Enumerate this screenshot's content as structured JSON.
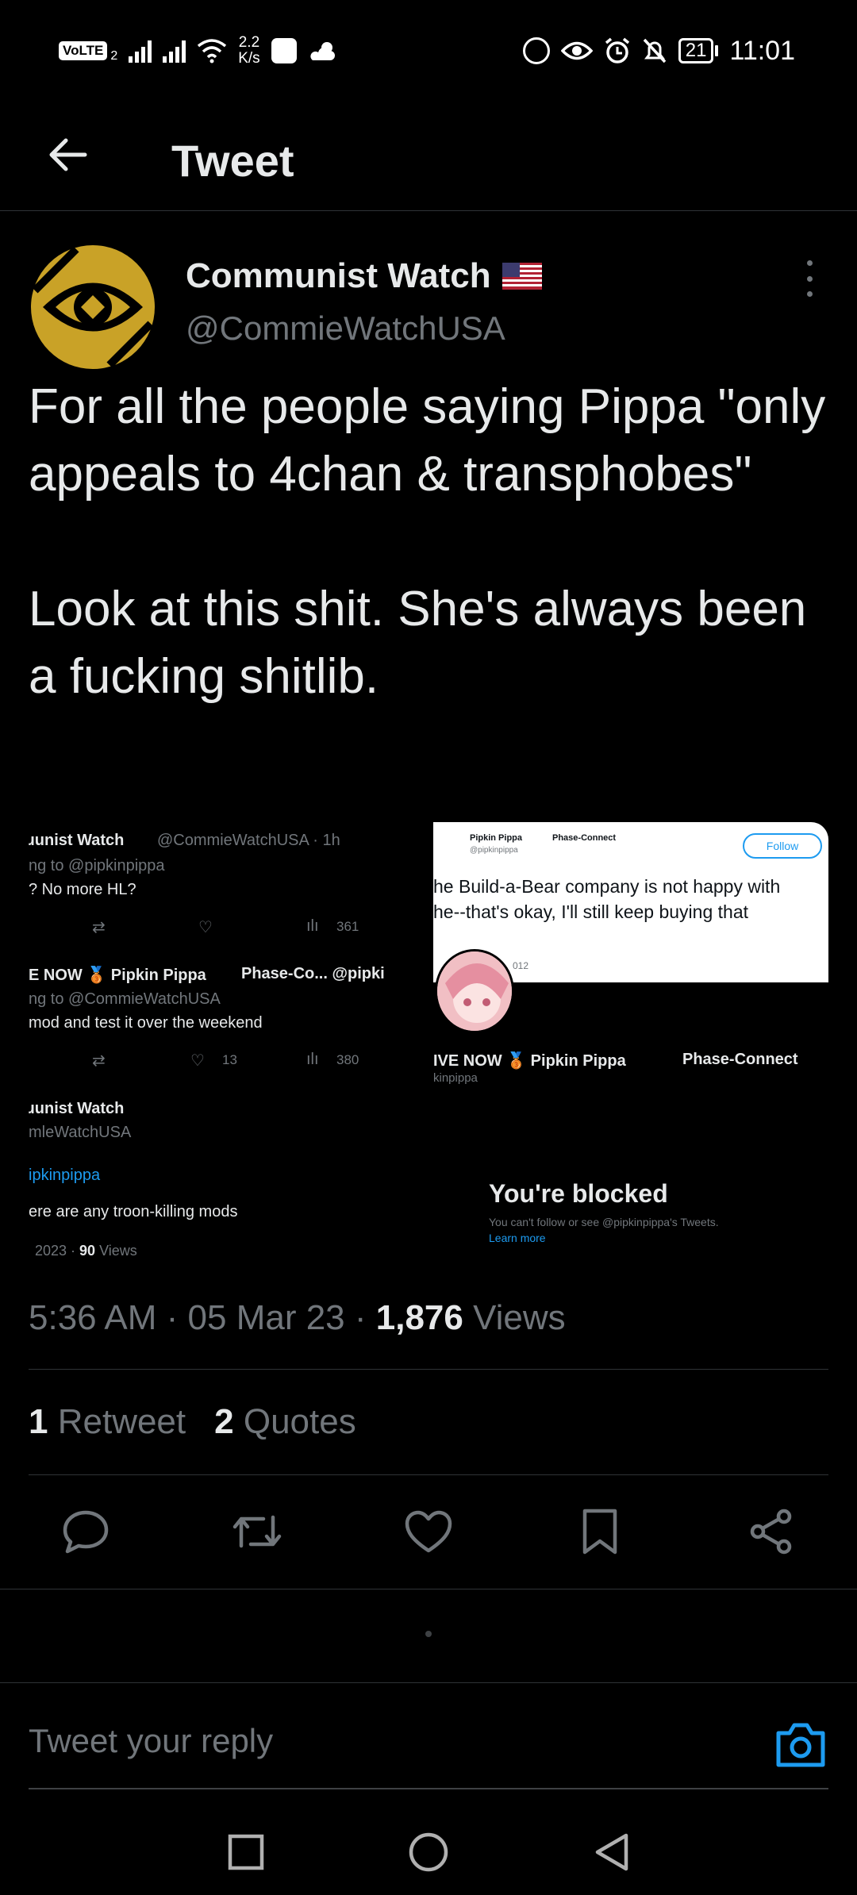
{
  "status_bar": {
    "volte": "VoLTE",
    "sim": "2",
    "net_speed_value": "2.2",
    "net_speed_unit": "K/s",
    "battery": "21",
    "time": "11:01"
  },
  "header": {
    "title": "Tweet"
  },
  "tweet": {
    "author_name": "Communist Watch",
    "author_handle": "@CommieWatchUSA",
    "text": "For all the people saying Pippa \"only appeals to 4chan & transphobes\"\n\nLook at this shit. She's always been a fucking shitlib.",
    "timestamp": "5:36 AM · 05 Mar 23 · ",
    "views_count": "1,876",
    "views_label": "Views"
  },
  "media": {
    "left": {
      "line1_name": "ɹunist Watch",
      "line1_handle": "@CommieWatchUSA · 1h",
      "line2": "ng to @pipkinpippa",
      "line3": "? No more HL?",
      "row1_views": "361",
      "line4_name": "E NOW 🥉 Pipkin Pippa",
      "line4_rest": "Phase-Co...  @pipki",
      "line5": "ng to @CommieWatchUSA",
      "line6": "mod and test it over the weekend",
      "row2_likes": "13",
      "row2_views": "380",
      "line7": "ɹunist Watch",
      "line8": "mleWatchUSA",
      "line9": "ipkinpippa",
      "line10": "ere are any troon-killing mods",
      "line11_date": "2023 · ",
      "line11_views": "90",
      "line11_label": "Views"
    },
    "right": {
      "card_name": "Pipkin Pippa",
      "card_name_rest": "Phase-Connect",
      "card_handle": "@pipkinpippa",
      "follow_label": "Follow",
      "card_text1": "he Build-a-Bear company is not happy with",
      "card_text2": "he--that's okay, I'll still keep buying  that",
      "card_year": "012",
      "live_label": "IVE NOW 🥉 Pipkin Pippa",
      "live_rest": "Phase-Connect",
      "live_handle": "kinpippa",
      "blocked_title": "You're blocked",
      "blocked_sub": "You can't follow or see @pipkinpippa's Tweets.",
      "blocked_link": "Learn more"
    }
  },
  "stats": {
    "retweets_count": "1",
    "retweets_label": "Retweet",
    "quotes_count": "2",
    "quotes_label": "Quotes"
  },
  "reply": {
    "placeholder": "Tweet your reply"
  },
  "colors": {
    "background": "#000000",
    "text_primary": "#e7e9ea",
    "text_secondary": "#71767b",
    "accent": "#1d9bf0",
    "avatar_gold": "#c9a227"
  },
  "icons": {
    "back": "arrow-left-icon",
    "more": "more-vertical-icon",
    "reply": "comment-icon",
    "retweet": "retweet-icon",
    "like": "heart-icon",
    "bookmark": "bookmark-icon",
    "share": "share-icon",
    "camera": "camera-icon"
  }
}
